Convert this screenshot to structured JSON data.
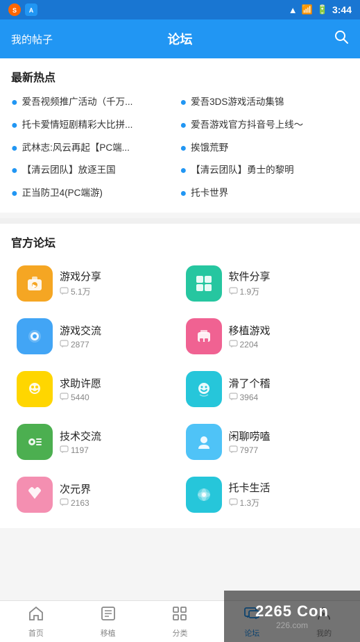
{
  "statusBar": {
    "time": "3:44"
  },
  "header": {
    "leftLabel": "我的帖子",
    "title": "论坛",
    "searchLabel": "🔍"
  },
  "hotSection": {
    "title": "最新热点",
    "items": [
      "爱吾视频推广活动（千万...",
      "爱吾3DS游戏活动集锦",
      "托卡爱情短剧精彩大比拼...",
      "爱吾游戏官方抖音号上线～",
      "武林志:风云再起【PC端...",
      "挨饿荒野",
      "【清云团队】放逐王国",
      "【清云团队】勇士的黎明",
      "正当防卫4(PC端游)",
      "托卡世界"
    ]
  },
  "forumSection": {
    "title": "官方论坛",
    "items": [
      {
        "name": "游戏分享",
        "count": "5.1万",
        "iconColor": "icon-orange",
        "iconEmoji": "🎮"
      },
      {
        "name": "软件分享",
        "count": "1.9万",
        "iconColor": "icon-teal",
        "iconEmoji": "⊞"
      },
      {
        "name": "游戏交流",
        "count": "2877",
        "iconColor": "icon-blue",
        "iconEmoji": "🎮"
      },
      {
        "name": "移植游戏",
        "count": "2204",
        "iconColor": "icon-pink",
        "iconEmoji": "🎮"
      },
      {
        "name": "求助许愿",
        "count": "5440",
        "iconColor": "icon-yellow",
        "iconEmoji": "😊"
      },
      {
        "name": "滑了个稽",
        "count": "3964",
        "iconColor": "icon-cyan",
        "iconEmoji": "😄"
      },
      {
        "name": "技术交流",
        "count": "1197",
        "iconColor": "icon-green-dark",
        "iconEmoji": "👾"
      },
      {
        "name": "闲聊唠嗑",
        "count": "7977",
        "iconColor": "icon-light-blue",
        "iconEmoji": "👤"
      },
      {
        "name": "次元界",
        "count": "2163",
        "iconColor": "icon-pink2",
        "iconEmoji": "🦊"
      },
      {
        "name": "托卡生活",
        "count": "1.3万",
        "iconColor": "icon-multi",
        "iconEmoji": "🌍"
      }
    ]
  },
  "bottomNav": {
    "items": [
      {
        "id": "home",
        "label": "首页",
        "icon": "🏠",
        "active": false
      },
      {
        "id": "migrate",
        "label": "移植",
        "icon": "🖼",
        "active": false
      },
      {
        "id": "category",
        "label": "分类",
        "icon": "📋",
        "active": false
      },
      {
        "id": "forum",
        "label": "论坛",
        "icon": "💬",
        "active": true
      },
      {
        "id": "mine",
        "label": "我的",
        "icon": "👤",
        "active": false
      }
    ]
  },
  "watermark": {
    "line1": "2265 Con",
    "line2": "226.com"
  }
}
